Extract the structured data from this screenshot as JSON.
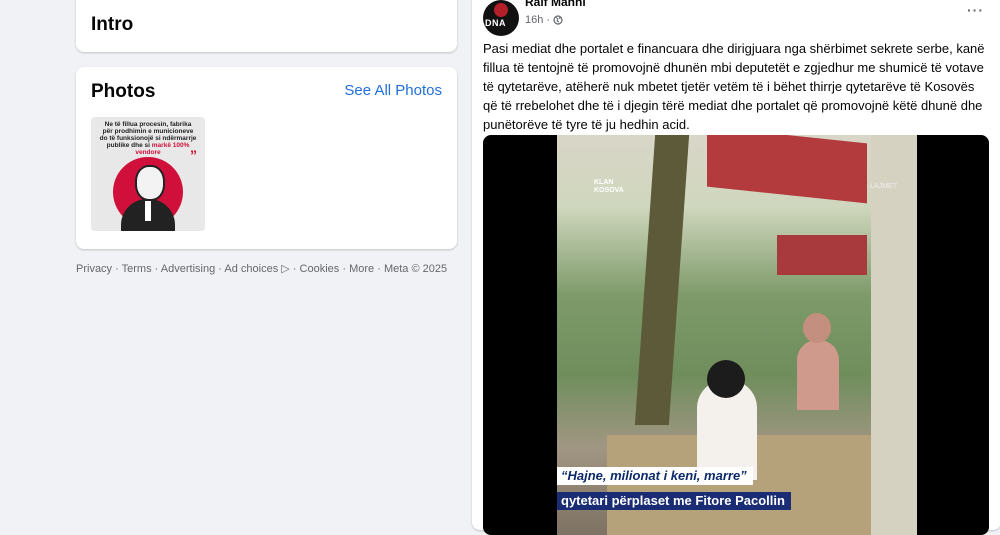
{
  "intro": {
    "title": "Intro"
  },
  "photos": {
    "title": "Photos",
    "see_all": "See All Photos",
    "thumbnail": {
      "quote_lines": [
        "Ne të fillua procesin, fabrika",
        "për prodhimin e municioneve",
        "do të funksionojë si ndërmarrje",
        "publike dhe si",
        "markë 100%",
        "vendore"
      ],
      "accent_color": "#d0103a"
    }
  },
  "footer": {
    "links": [
      "Privacy",
      "Terms",
      "Advertising",
      "Ad choices",
      "Cookies",
      "More"
    ],
    "separator": "·",
    "ad_icon": "▷",
    "copyright": "Meta © 2025"
  },
  "post": {
    "author": "Ralf Manni",
    "time": "16h",
    "meta_separator": "·",
    "privacy_icon": "globe-icon",
    "more_label": "···",
    "avatar_text": "DNA",
    "text": "Pasi mediat dhe portalet e financuara dhe dirigjuara nga shërbimet sekrete serbe, kanë fillua të tentojnë të promovojnë dhunën mbi deputetët e zgjedhur me shumicë të votave të qytetarëve,  atëherë nuk mbetet tjetër vetëm të i bëhet thirrje qytetarëve të Kosovës që të rrebelohet dhe të i djegin tërë mediat dhe portalet që promovojnë këtë dhunë dhe punëtorëve të tyre të ju hedhin acid.",
    "video": {
      "logo_top": "KLAN",
      "logo_bottom": "KOSOVA",
      "corner_label": "LAJMET",
      "caption_line1": "“Hajne, milionat i keni, marre”",
      "caption_line2": "qytetari  përplaset me Fitore Pacollin"
    }
  },
  "colors": {
    "background": "#f0f2f5",
    "link": "#216fdb",
    "caption_bg": "#1a2c73",
    "muted": "#65676b"
  }
}
